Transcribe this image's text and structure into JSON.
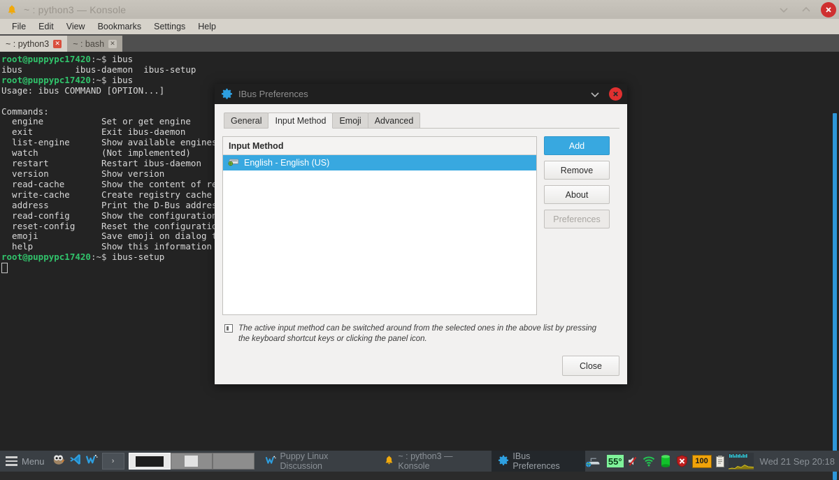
{
  "konsole": {
    "title": "~ : python3 — Konsole",
    "title_icon": "bell-icon",
    "menu": [
      "File",
      "Edit",
      "View",
      "Bookmarks",
      "Settings",
      "Help"
    ],
    "tabs": [
      {
        "label": "~ : python3",
        "active": true,
        "close_glyph": "✕"
      },
      {
        "label": "~ : bash",
        "active": false,
        "close_glyph": "✕"
      }
    ],
    "window_buttons": {
      "minimize": "⌄",
      "maximize": "⌃",
      "close": "✕"
    },
    "terminal": {
      "prompt_user": "root@puppypc17420",
      "prompt_path": ":~$ ",
      "lines": [
        {
          "type": "prompt",
          "command": "ibus"
        },
        {
          "type": "out",
          "text": "ibus          ibus-daemon  ibus-setup"
        },
        {
          "type": "prompt",
          "command": "ibus"
        },
        {
          "type": "out",
          "text": "Usage: ibus COMMAND [OPTION...]"
        },
        {
          "type": "out",
          "text": ""
        },
        {
          "type": "out",
          "text": "Commands:"
        },
        {
          "type": "out",
          "text": "  engine           Set or get engine"
        },
        {
          "type": "out",
          "text": "  exit             Exit ibus-daemon"
        },
        {
          "type": "out",
          "text": "  list-engine      Show available engines"
        },
        {
          "type": "out",
          "text": "  watch            (Not implemented)"
        },
        {
          "type": "out",
          "text": "  restart          Restart ibus-daemon"
        },
        {
          "type": "out",
          "text": "  version          Show version"
        },
        {
          "type": "out",
          "text": "  read-cache       Show the content of registry cache"
        },
        {
          "type": "out",
          "text": "  write-cache      Create registry cache"
        },
        {
          "type": "out",
          "text": "  address          Print the D-Bus address of ibus-daemon"
        },
        {
          "type": "out",
          "text": "  read-config      Show the configuration values"
        },
        {
          "type": "out",
          "text": "  reset-config     Reset the configuration values"
        },
        {
          "type": "out",
          "text": "  emoji            Save emoji on dialog to clipboard"
        },
        {
          "type": "out",
          "text": "  help             Show this information"
        },
        {
          "type": "prompt",
          "command": "ibus-setup"
        }
      ]
    }
  },
  "ibus_dialog": {
    "title": "IBus Preferences",
    "title_icon": "gear-icon",
    "window_buttons": {
      "minimize": "⌄",
      "close": "✕"
    },
    "tabs": [
      {
        "label": "General",
        "active": false
      },
      {
        "label": "Input Method",
        "active": true
      },
      {
        "label": "Emoji",
        "active": false
      },
      {
        "label": "Advanced",
        "active": false
      }
    ],
    "list": {
      "header": "Input Method",
      "rows": [
        {
          "label": "English - English (US)",
          "icon": "keyboard-icon",
          "selected": true
        }
      ]
    },
    "buttons": [
      {
        "label": "Add",
        "style": "primary",
        "disabled": false
      },
      {
        "label": "Remove",
        "style": "normal",
        "disabled": false
      },
      {
        "label": "About",
        "style": "normal",
        "disabled": false
      },
      {
        "label": "Preferences",
        "style": "normal",
        "disabled": true
      }
    ],
    "hint": {
      "icon": "info-icon",
      "text": "The active input method can be switched around from the selected ones in the above list by pressing the keyboard shortcut keys or clicking the panel icon."
    },
    "close_button": "Close"
  },
  "taskbar": {
    "menu_label": "Menu",
    "launchers": [
      "gimp-icon",
      "vscode-icon",
      "w-browser-icon"
    ],
    "expand_arrow": "›",
    "windows": [
      {
        "label": "Puppy Linux Discussion",
        "icon": "w-browser-icon",
        "active": false
      },
      {
        "label": "~ : python3 — Konsole",
        "icon": "bell-icon",
        "active": false
      },
      {
        "label": "IBus Preferences",
        "icon": "gear-icon",
        "active": true
      }
    ],
    "tray": {
      "temperature": "55°",
      "battery": "100",
      "icons": [
        "network-globe-icon",
        "volume-muted-icon",
        "wifi-icon",
        "disk-icon",
        "shield-icon",
        "battery-icon",
        "clipboard-icon",
        "cpu-graph-icon"
      ]
    },
    "clock": "Wed 21 Sep 20:18"
  },
  "colors": {
    "accent_blue": "#38a8e0",
    "terminal_bg": "#232323",
    "prompt_green": "#31c36b",
    "close_red": "#cf3030",
    "temp_green": "#7ff39a",
    "battery_orange": "#f0a30a"
  }
}
